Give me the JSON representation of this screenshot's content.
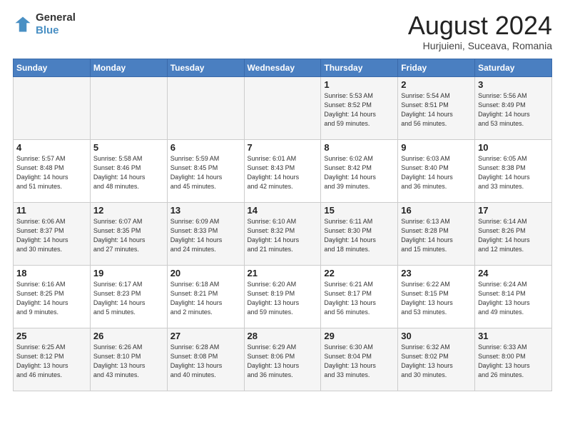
{
  "header": {
    "logo_line1": "General",
    "logo_line2": "Blue",
    "month": "August 2024",
    "location": "Hurjuieni, Suceava, Romania"
  },
  "weekdays": [
    "Sunday",
    "Monday",
    "Tuesday",
    "Wednesday",
    "Thursday",
    "Friday",
    "Saturday"
  ],
  "weeks": [
    [
      {
        "day": "",
        "info": ""
      },
      {
        "day": "",
        "info": ""
      },
      {
        "day": "",
        "info": ""
      },
      {
        "day": "",
        "info": ""
      },
      {
        "day": "1",
        "info": "Sunrise: 5:53 AM\nSunset: 8:52 PM\nDaylight: 14 hours\nand 59 minutes."
      },
      {
        "day": "2",
        "info": "Sunrise: 5:54 AM\nSunset: 8:51 PM\nDaylight: 14 hours\nand 56 minutes."
      },
      {
        "day": "3",
        "info": "Sunrise: 5:56 AM\nSunset: 8:49 PM\nDaylight: 14 hours\nand 53 minutes."
      }
    ],
    [
      {
        "day": "4",
        "info": "Sunrise: 5:57 AM\nSunset: 8:48 PM\nDaylight: 14 hours\nand 51 minutes."
      },
      {
        "day": "5",
        "info": "Sunrise: 5:58 AM\nSunset: 8:46 PM\nDaylight: 14 hours\nand 48 minutes."
      },
      {
        "day": "6",
        "info": "Sunrise: 5:59 AM\nSunset: 8:45 PM\nDaylight: 14 hours\nand 45 minutes."
      },
      {
        "day": "7",
        "info": "Sunrise: 6:01 AM\nSunset: 8:43 PM\nDaylight: 14 hours\nand 42 minutes."
      },
      {
        "day": "8",
        "info": "Sunrise: 6:02 AM\nSunset: 8:42 PM\nDaylight: 14 hours\nand 39 minutes."
      },
      {
        "day": "9",
        "info": "Sunrise: 6:03 AM\nSunset: 8:40 PM\nDaylight: 14 hours\nand 36 minutes."
      },
      {
        "day": "10",
        "info": "Sunrise: 6:05 AM\nSunset: 8:38 PM\nDaylight: 14 hours\nand 33 minutes."
      }
    ],
    [
      {
        "day": "11",
        "info": "Sunrise: 6:06 AM\nSunset: 8:37 PM\nDaylight: 14 hours\nand 30 minutes."
      },
      {
        "day": "12",
        "info": "Sunrise: 6:07 AM\nSunset: 8:35 PM\nDaylight: 14 hours\nand 27 minutes."
      },
      {
        "day": "13",
        "info": "Sunrise: 6:09 AM\nSunset: 8:33 PM\nDaylight: 14 hours\nand 24 minutes."
      },
      {
        "day": "14",
        "info": "Sunrise: 6:10 AM\nSunset: 8:32 PM\nDaylight: 14 hours\nand 21 minutes."
      },
      {
        "day": "15",
        "info": "Sunrise: 6:11 AM\nSunset: 8:30 PM\nDaylight: 14 hours\nand 18 minutes."
      },
      {
        "day": "16",
        "info": "Sunrise: 6:13 AM\nSunset: 8:28 PM\nDaylight: 14 hours\nand 15 minutes."
      },
      {
        "day": "17",
        "info": "Sunrise: 6:14 AM\nSunset: 8:26 PM\nDaylight: 14 hours\nand 12 minutes."
      }
    ],
    [
      {
        "day": "18",
        "info": "Sunrise: 6:16 AM\nSunset: 8:25 PM\nDaylight: 14 hours\nand 9 minutes."
      },
      {
        "day": "19",
        "info": "Sunrise: 6:17 AM\nSunset: 8:23 PM\nDaylight: 14 hours\nand 5 minutes."
      },
      {
        "day": "20",
        "info": "Sunrise: 6:18 AM\nSunset: 8:21 PM\nDaylight: 14 hours\nand 2 minutes."
      },
      {
        "day": "21",
        "info": "Sunrise: 6:20 AM\nSunset: 8:19 PM\nDaylight: 13 hours\nand 59 minutes."
      },
      {
        "day": "22",
        "info": "Sunrise: 6:21 AM\nSunset: 8:17 PM\nDaylight: 13 hours\nand 56 minutes."
      },
      {
        "day": "23",
        "info": "Sunrise: 6:22 AM\nSunset: 8:15 PM\nDaylight: 13 hours\nand 53 minutes."
      },
      {
        "day": "24",
        "info": "Sunrise: 6:24 AM\nSunset: 8:14 PM\nDaylight: 13 hours\nand 49 minutes."
      }
    ],
    [
      {
        "day": "25",
        "info": "Sunrise: 6:25 AM\nSunset: 8:12 PM\nDaylight: 13 hours\nand 46 minutes."
      },
      {
        "day": "26",
        "info": "Sunrise: 6:26 AM\nSunset: 8:10 PM\nDaylight: 13 hours\nand 43 minutes."
      },
      {
        "day": "27",
        "info": "Sunrise: 6:28 AM\nSunset: 8:08 PM\nDaylight: 13 hours\nand 40 minutes."
      },
      {
        "day": "28",
        "info": "Sunrise: 6:29 AM\nSunset: 8:06 PM\nDaylight: 13 hours\nand 36 minutes."
      },
      {
        "day": "29",
        "info": "Sunrise: 6:30 AM\nSunset: 8:04 PM\nDaylight: 13 hours\nand 33 minutes."
      },
      {
        "day": "30",
        "info": "Sunrise: 6:32 AM\nSunset: 8:02 PM\nDaylight: 13 hours\nand 30 minutes."
      },
      {
        "day": "31",
        "info": "Sunrise: 6:33 AM\nSunset: 8:00 PM\nDaylight: 13 hours\nand 26 minutes."
      }
    ]
  ]
}
